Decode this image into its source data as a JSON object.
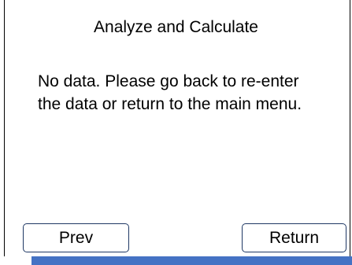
{
  "screen": {
    "title": "Analyze and Calculate",
    "message": "No data. Please go back to re-enter the data or return to the main menu."
  },
  "buttons": {
    "prev_label": "Prev",
    "return_label": "Return"
  },
  "colors": {
    "button_border": "#1f3864",
    "bottom_bar": "#4472c4"
  }
}
